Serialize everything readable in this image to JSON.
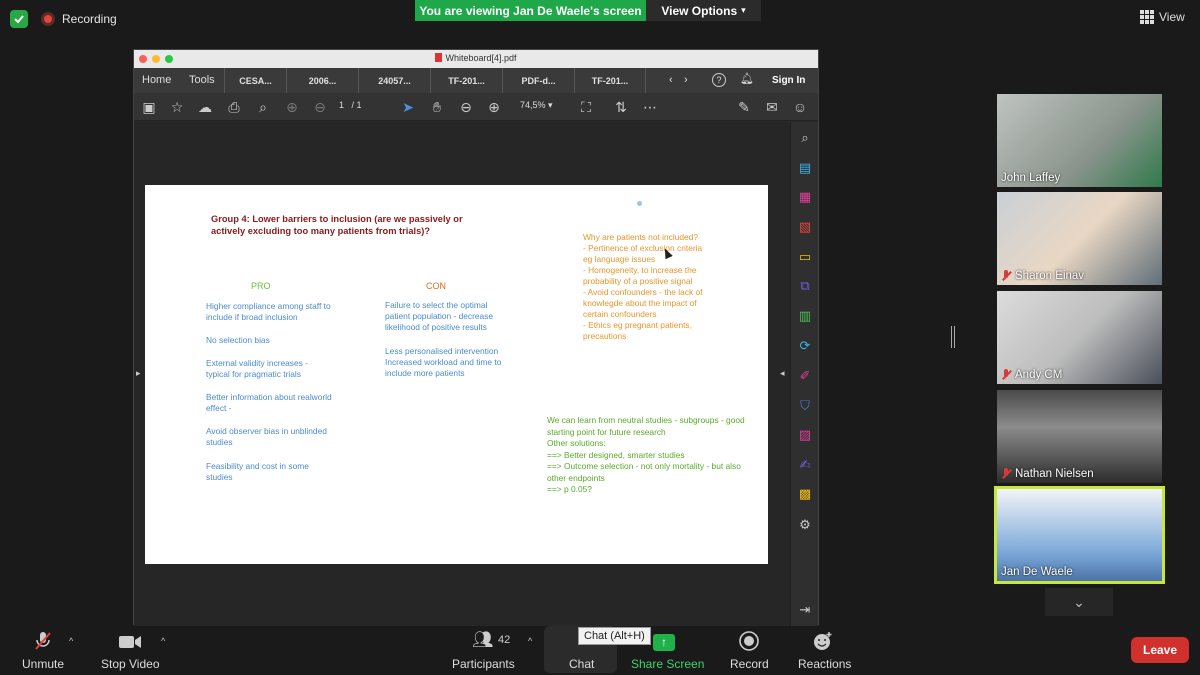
{
  "status": {
    "recording_label": "Recording",
    "viewing_banner": "You are viewing Jan De Waele's screen",
    "view_options_label": "View Options",
    "view_label": "View"
  },
  "shared_window": {
    "title": "Whiteboard[4].pdf",
    "menu": [
      "Home",
      "Tools"
    ],
    "tabs": [
      "CESA...",
      "2006...",
      "24057...",
      "TF-201...",
      "PDF-d...",
      "TF-201..."
    ],
    "sign_in": "Sign In",
    "page_current": "1",
    "page_total": "/ 1",
    "zoom": "74,5%"
  },
  "slide": {
    "title": "Group 4: Lower barriers to inclusion (are we passively or actively excluding too many patients from trials)?",
    "pro_heading": "PRO",
    "con_heading": "CON",
    "pro_items": [
      "Higher compliance  among staff to include if broad inclusion",
      "No selection bias",
      "External validity increases - typical for pragmatic trials",
      "Better information about realworld effect -",
      "Avoid observer bias in unblinded studies",
      "Feasibility and cost in some studies"
    ],
    "con_items": [
      "Failure to select the optimal patient population - decrease likelihood of positive results",
      "Less personalised intervention Increased workload and time to include more patients"
    ],
    "why_block": "Why are patients not included?\n- Pertinence of exclusion criteria eg language issues\n- Homogeneity, to increase the probability of a positive signal\n- Avoid confounders - the lack of knowlegde about the impact of certain confounders\n- Ethics eg pregnant patients, precautions",
    "learn_block": "We can learn from neutral studies - subgroups - good starting point for future research\nOther solutions:\n==> Better designed, smarter studies\n==> Outcome selection - not only mortality - but also other endpoints\n==> p 0.05?"
  },
  "participants": [
    {
      "name": "John Laffey",
      "muted": false
    },
    {
      "name": "Sharon Einav",
      "muted": true
    },
    {
      "name": "Andy CM",
      "muted": true
    },
    {
      "name": "Nathan Nielsen",
      "muted": true
    },
    {
      "name": "Jan De Waele",
      "muted": false
    }
  ],
  "bottom": {
    "unmute": "Unmute",
    "stop_video": "Stop Video",
    "participants": "Participants",
    "participants_count": "42",
    "chat": "Chat",
    "chat_tooltip": "Chat (Alt+H)",
    "share_screen": "Share Screen",
    "record": "Record",
    "reactions": "Reactions",
    "leave": "Leave"
  }
}
